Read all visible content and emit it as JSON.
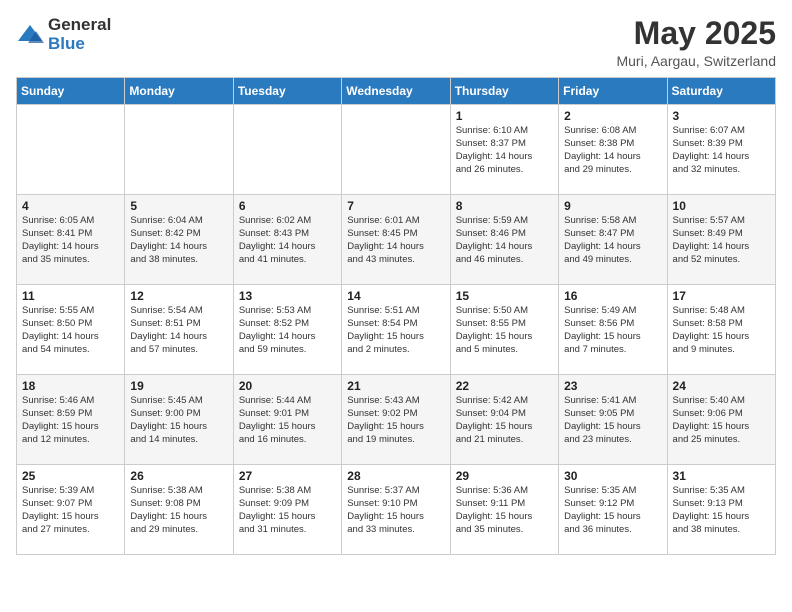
{
  "logo": {
    "general": "General",
    "blue": "Blue"
  },
  "calendar": {
    "title": "May 2025",
    "subtitle": "Muri, Aargau, Switzerland",
    "days_of_week": [
      "Sunday",
      "Monday",
      "Tuesday",
      "Wednesday",
      "Thursday",
      "Friday",
      "Saturday"
    ],
    "weeks": [
      [
        {
          "day": "",
          "info": ""
        },
        {
          "day": "",
          "info": ""
        },
        {
          "day": "",
          "info": ""
        },
        {
          "day": "",
          "info": ""
        },
        {
          "day": "1",
          "info": "Sunrise: 6:10 AM\nSunset: 8:37 PM\nDaylight: 14 hours\nand 26 minutes."
        },
        {
          "day": "2",
          "info": "Sunrise: 6:08 AM\nSunset: 8:38 PM\nDaylight: 14 hours\nand 29 minutes."
        },
        {
          "day": "3",
          "info": "Sunrise: 6:07 AM\nSunset: 8:39 PM\nDaylight: 14 hours\nand 32 minutes."
        }
      ],
      [
        {
          "day": "4",
          "info": "Sunrise: 6:05 AM\nSunset: 8:41 PM\nDaylight: 14 hours\nand 35 minutes."
        },
        {
          "day": "5",
          "info": "Sunrise: 6:04 AM\nSunset: 8:42 PM\nDaylight: 14 hours\nand 38 minutes."
        },
        {
          "day": "6",
          "info": "Sunrise: 6:02 AM\nSunset: 8:43 PM\nDaylight: 14 hours\nand 41 minutes."
        },
        {
          "day": "7",
          "info": "Sunrise: 6:01 AM\nSunset: 8:45 PM\nDaylight: 14 hours\nand 43 minutes."
        },
        {
          "day": "8",
          "info": "Sunrise: 5:59 AM\nSunset: 8:46 PM\nDaylight: 14 hours\nand 46 minutes."
        },
        {
          "day": "9",
          "info": "Sunrise: 5:58 AM\nSunset: 8:47 PM\nDaylight: 14 hours\nand 49 minutes."
        },
        {
          "day": "10",
          "info": "Sunrise: 5:57 AM\nSunset: 8:49 PM\nDaylight: 14 hours\nand 52 minutes."
        }
      ],
      [
        {
          "day": "11",
          "info": "Sunrise: 5:55 AM\nSunset: 8:50 PM\nDaylight: 14 hours\nand 54 minutes."
        },
        {
          "day": "12",
          "info": "Sunrise: 5:54 AM\nSunset: 8:51 PM\nDaylight: 14 hours\nand 57 minutes."
        },
        {
          "day": "13",
          "info": "Sunrise: 5:53 AM\nSunset: 8:52 PM\nDaylight: 14 hours\nand 59 minutes."
        },
        {
          "day": "14",
          "info": "Sunrise: 5:51 AM\nSunset: 8:54 PM\nDaylight: 15 hours\nand 2 minutes."
        },
        {
          "day": "15",
          "info": "Sunrise: 5:50 AM\nSunset: 8:55 PM\nDaylight: 15 hours\nand 5 minutes."
        },
        {
          "day": "16",
          "info": "Sunrise: 5:49 AM\nSunset: 8:56 PM\nDaylight: 15 hours\nand 7 minutes."
        },
        {
          "day": "17",
          "info": "Sunrise: 5:48 AM\nSunset: 8:58 PM\nDaylight: 15 hours\nand 9 minutes."
        }
      ],
      [
        {
          "day": "18",
          "info": "Sunrise: 5:46 AM\nSunset: 8:59 PM\nDaylight: 15 hours\nand 12 minutes."
        },
        {
          "day": "19",
          "info": "Sunrise: 5:45 AM\nSunset: 9:00 PM\nDaylight: 15 hours\nand 14 minutes."
        },
        {
          "day": "20",
          "info": "Sunrise: 5:44 AM\nSunset: 9:01 PM\nDaylight: 15 hours\nand 16 minutes."
        },
        {
          "day": "21",
          "info": "Sunrise: 5:43 AM\nSunset: 9:02 PM\nDaylight: 15 hours\nand 19 minutes."
        },
        {
          "day": "22",
          "info": "Sunrise: 5:42 AM\nSunset: 9:04 PM\nDaylight: 15 hours\nand 21 minutes."
        },
        {
          "day": "23",
          "info": "Sunrise: 5:41 AM\nSunset: 9:05 PM\nDaylight: 15 hours\nand 23 minutes."
        },
        {
          "day": "24",
          "info": "Sunrise: 5:40 AM\nSunset: 9:06 PM\nDaylight: 15 hours\nand 25 minutes."
        }
      ],
      [
        {
          "day": "25",
          "info": "Sunrise: 5:39 AM\nSunset: 9:07 PM\nDaylight: 15 hours\nand 27 minutes."
        },
        {
          "day": "26",
          "info": "Sunrise: 5:38 AM\nSunset: 9:08 PM\nDaylight: 15 hours\nand 29 minutes."
        },
        {
          "day": "27",
          "info": "Sunrise: 5:38 AM\nSunset: 9:09 PM\nDaylight: 15 hours\nand 31 minutes."
        },
        {
          "day": "28",
          "info": "Sunrise: 5:37 AM\nSunset: 9:10 PM\nDaylight: 15 hours\nand 33 minutes."
        },
        {
          "day": "29",
          "info": "Sunrise: 5:36 AM\nSunset: 9:11 PM\nDaylight: 15 hours\nand 35 minutes."
        },
        {
          "day": "30",
          "info": "Sunrise: 5:35 AM\nSunset: 9:12 PM\nDaylight: 15 hours\nand 36 minutes."
        },
        {
          "day": "31",
          "info": "Sunrise: 5:35 AM\nSunset: 9:13 PM\nDaylight: 15 hours\nand 38 minutes."
        }
      ]
    ]
  }
}
